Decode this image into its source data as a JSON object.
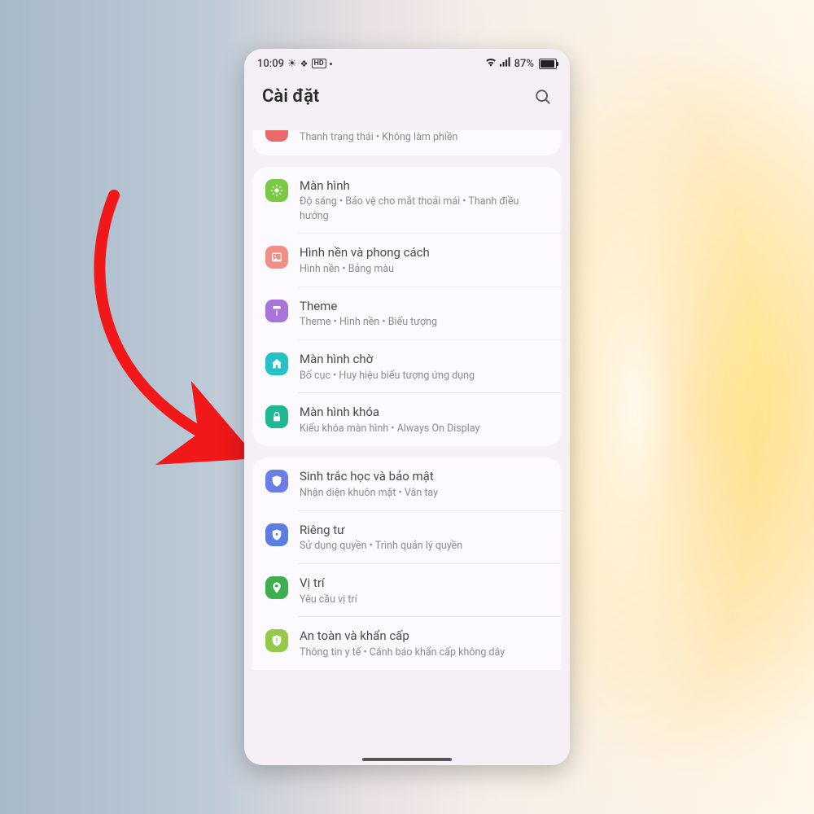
{
  "status": {
    "time": "10:09",
    "battery_pct": "87%"
  },
  "header": {
    "title": "Cài đặt"
  },
  "group0": {
    "notifications": {
      "sub": "Thanh trạng thái  •  Không làm phiền"
    }
  },
  "group1": {
    "display": {
      "title": "Màn hình",
      "sub": "Độ sáng  •  Bảo vệ cho mắt thoải mái  •  Thanh điều hướng"
    },
    "wallpaper": {
      "title": "Hình nền và phong cách",
      "sub": "Hình nền  •  Bảng màu"
    },
    "theme": {
      "title": "Theme",
      "sub": "Theme  •  Hình nền  •  Biểu tượng"
    },
    "home": {
      "title": "Màn hình chờ",
      "sub": "Bố cục  •  Huy hiệu biểu tượng ứng dụng"
    },
    "lock": {
      "title": "Màn hình khóa",
      "sub": "Kiểu khóa màn hình  •  Always On Display"
    }
  },
  "group2": {
    "biometrics": {
      "title": "Sinh trắc học và bảo mật",
      "sub": "Nhận diện khuôn mặt  •  Vân tay"
    },
    "privacy": {
      "title": "Riêng tư",
      "sub": "Sử dụng quyền  •  Trình quản lý quyền"
    },
    "location": {
      "title": "Vị trí",
      "sub": "Yêu cầu vị trí"
    },
    "safety": {
      "title": "An toàn và khẩn cấp",
      "sub": "Thông tin y tế  •  Cảnh báo khẩn cấp không dây"
    }
  },
  "colors": {
    "arrow": "#f01818"
  }
}
